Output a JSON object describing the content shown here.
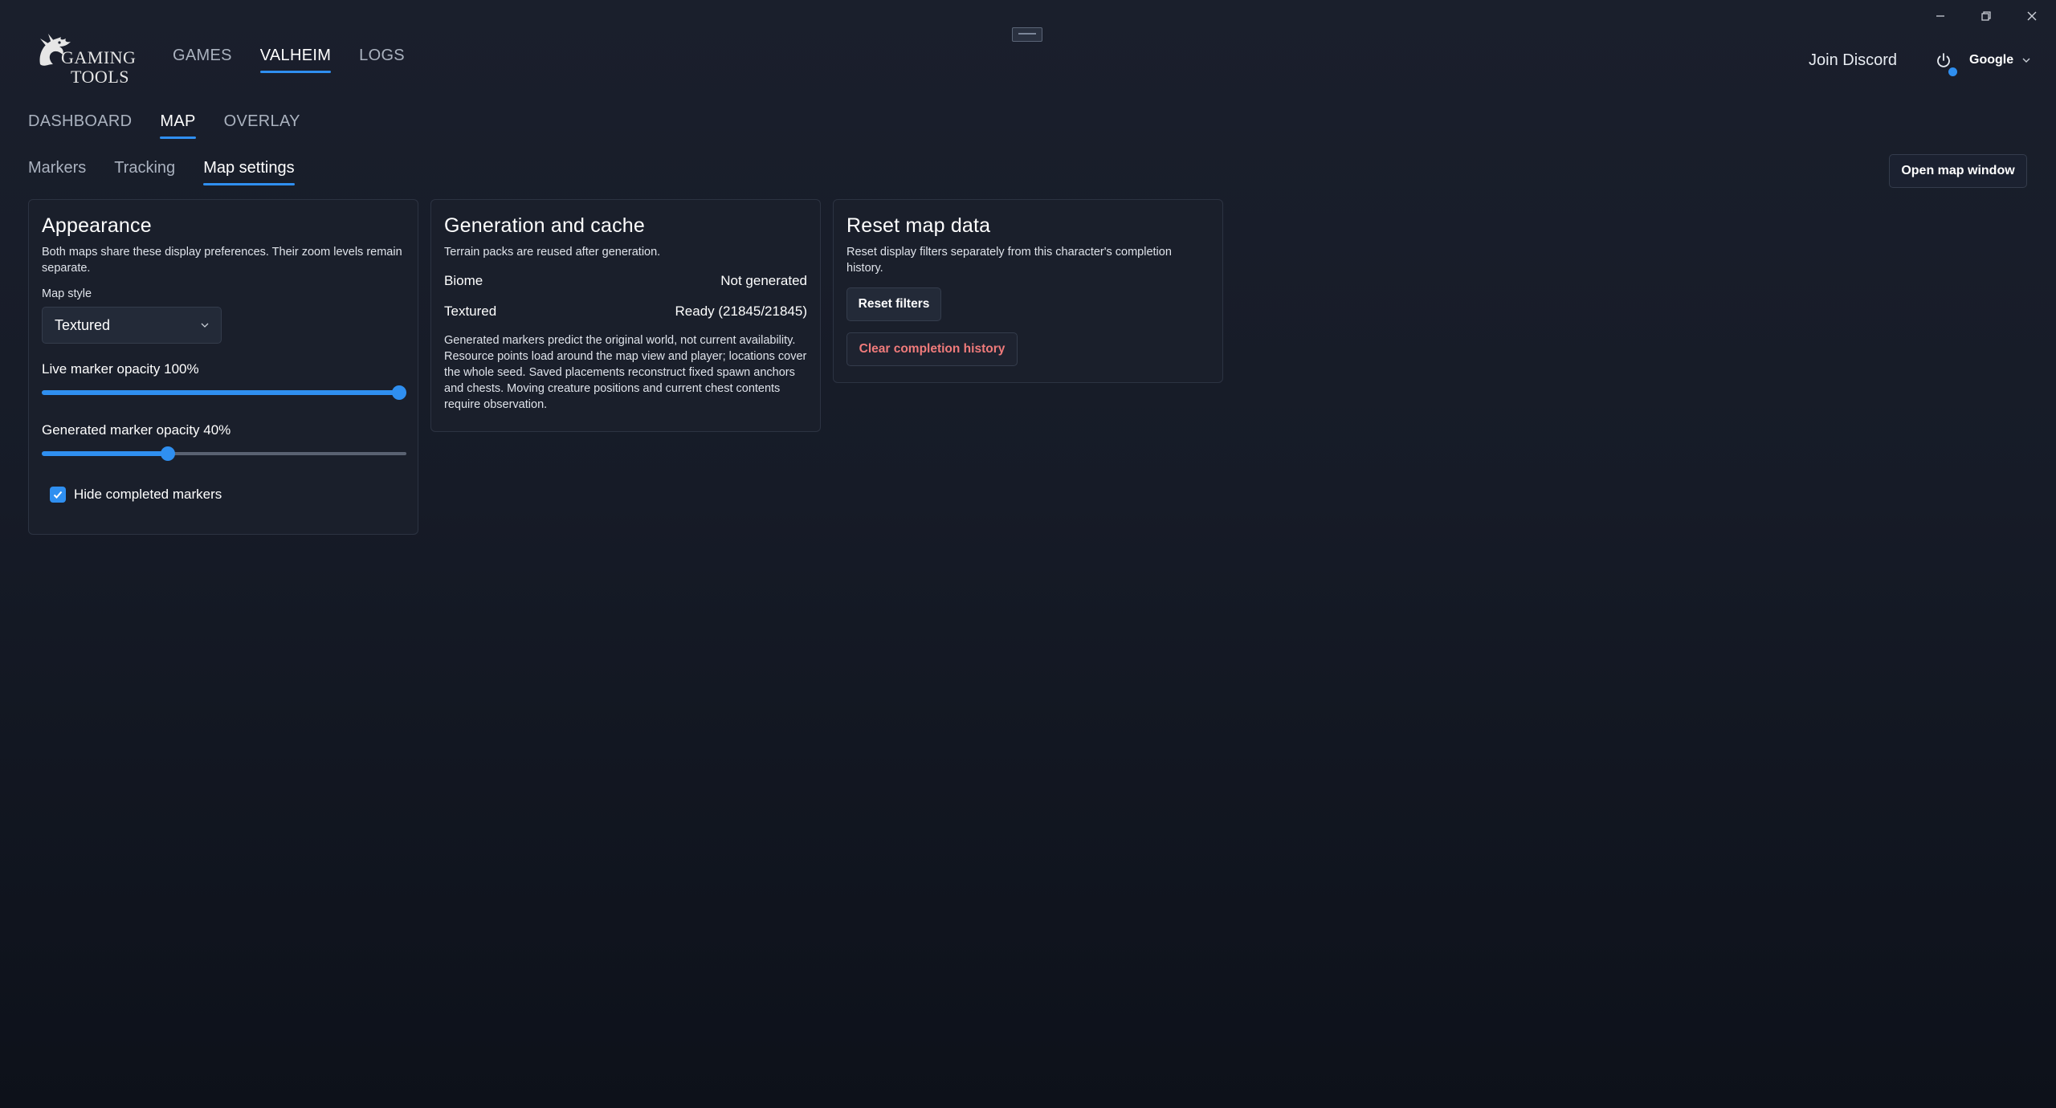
{
  "brand": {
    "logo_text_line1": "GAMING",
    "logo_text_line2": "TOOLS"
  },
  "top_nav": [
    {
      "label": "GAMES",
      "active": false
    },
    {
      "label": "VALHEIM",
      "active": true
    },
    {
      "label": "LOGS",
      "active": false
    }
  ],
  "sub_nav": [
    {
      "label": "DASHBOARD",
      "active": false
    },
    {
      "label": "MAP",
      "active": true
    },
    {
      "label": "OVERLAY",
      "active": false
    }
  ],
  "tabs": [
    {
      "label": "Markers",
      "active": false
    },
    {
      "label": "Tracking",
      "active": false
    },
    {
      "label": "Map settings",
      "active": true
    }
  ],
  "header": {
    "join_discord": "Join Discord",
    "account_name": "Google",
    "open_map_window": "Open map window"
  },
  "appearance": {
    "title": "Appearance",
    "description": "Both maps share these display preferences. Their zoom levels remain separate.",
    "map_style_label": "Map style",
    "map_style_value": "Textured",
    "live_opacity_label": "Live marker opacity 100%",
    "live_opacity_value": 100,
    "generated_opacity_label": "Generated marker opacity 40%",
    "generated_opacity_value": 34,
    "hide_completed_label": "Hide completed markers",
    "hide_completed_checked": true
  },
  "generation": {
    "title": "Generation and cache",
    "description": "Terrain packs are reused after generation.",
    "rows": [
      {
        "key": "Biome",
        "value": "Not generated"
      },
      {
        "key": "Textured",
        "value": "Ready (21845/21845)"
      }
    ],
    "note": "Generated markers predict the original world, not current availability. Resource points load around the map view and player; locations cover the whole seed. Saved placements reconstruct fixed spawn anchors and chests. Moving creature positions and current chest contents require observation."
  },
  "reset": {
    "title": "Reset map data",
    "description": "Reset display filters separately from this character's completion history.",
    "reset_filters": "Reset filters",
    "clear_history": "Clear completion history"
  },
  "colors": {
    "accent": "#2f8ff0",
    "danger": "#f07b7b",
    "card_bg": "#1a1f2b"
  }
}
